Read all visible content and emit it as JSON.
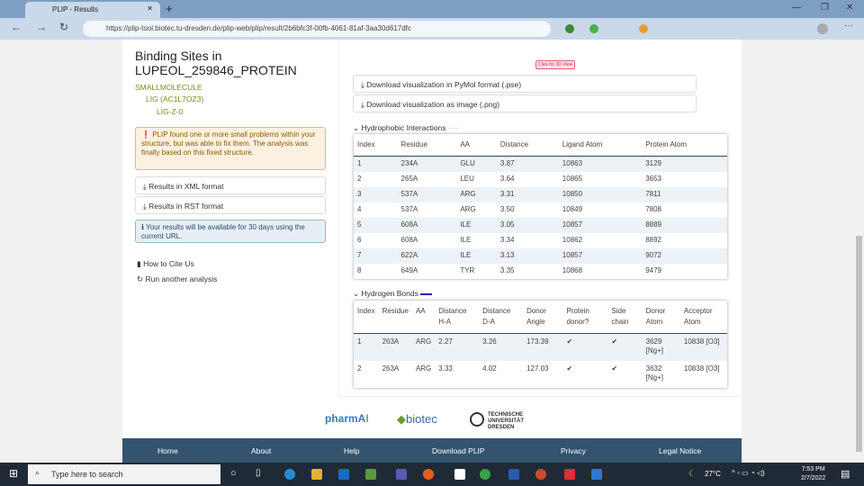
{
  "browser": {
    "tab_title": "PLIP - Results",
    "url": "https://plip-tool.biotec.tu-dresden.de/plip-web/plip/result/2b6bfc3f-00fb-4061-81af-3aa30d617dfc"
  },
  "sidebar": {
    "title_line1": "Binding Sites in",
    "title_line2": "LUPEOL_259846_PROTEIN",
    "tree": [
      "SMALLMOLECULE",
      "LIG (AC1L7OZ3)",
      "LIG-Z-0"
    ],
    "warning": "PLIP found one or more small problems within your structure, but was able to fix them. The analysis was finally based on this fixed structure.",
    "xml_label": "Results in XML format",
    "rst_label": "Results in RST format",
    "info": "Your results will be available for 30 days using the current URL.",
    "cite_label": "How to Cite Us",
    "run_label": "Run another analysis"
  },
  "main": {
    "view3d_label": "Click for 3D-View",
    "pymol_label": "Download visualization in PyMol format (.pse)",
    "png_label": "Download visualization as image (.png)",
    "hydrophobic": {
      "title": "Hydrophobic Interactions",
      "headers": [
        "Index",
        "Residue",
        "AA",
        "Distance",
        "Ligand Atom",
        "Protein Atom"
      ],
      "rows": [
        [
          "1",
          "234A",
          "GLU",
          "3.87",
          "10863",
          "3129"
        ],
        [
          "2",
          "265A",
          "LEU",
          "3.64",
          "10865",
          "3653"
        ],
        [
          "3",
          "537A",
          "ARG",
          "3.31",
          "10850",
          "7811"
        ],
        [
          "4",
          "537A",
          "ARG",
          "3.50",
          "10849",
          "7808"
        ],
        [
          "5",
          "608A",
          "ILE",
          "3.05",
          "10857",
          "8889"
        ],
        [
          "6",
          "608A",
          "ILE",
          "3.34",
          "10862",
          "8892"
        ],
        [
          "7",
          "622A",
          "ILE",
          "3.13",
          "10857",
          "9072"
        ],
        [
          "8",
          "649A",
          "TYR",
          "3.35",
          "10868",
          "9479"
        ]
      ]
    },
    "hbonds": {
      "title": "Hydrogen Bonds",
      "headers": [
        "Index",
        "Residue",
        "AA",
        "Distance H-A",
        "Distance D-A",
        "Donor Angle",
        "Protein donor?",
        "Side chain",
        "Donor Atom",
        "Acceptor Atom"
      ],
      "rows": [
        [
          "1",
          "263A",
          "ARG",
          "2.27",
          "3.26",
          "173.39",
          "✔",
          "✔",
          "3629 [Ng+]",
          "10838 [O3]"
        ],
        [
          "2",
          "263A",
          "ARG",
          "3.33",
          "4.02",
          "127.03",
          "✔",
          "✔",
          "3632 [Ng+]",
          "10838 [O3]"
        ]
      ]
    }
  },
  "logos": {
    "pharmai": "pharmAI",
    "biotec": "biotec",
    "tud": "TECHNISCHE UNIVERSITÄT DRESDEN"
  },
  "footer": [
    "Home",
    "About",
    "Help",
    "Download PLIP",
    "Privacy",
    "Legal Notice"
  ],
  "taskbar": {
    "search_placeholder": "Type here to search",
    "weather": "27°C",
    "time": "7:53 PM",
    "date": "2/7/2022"
  }
}
